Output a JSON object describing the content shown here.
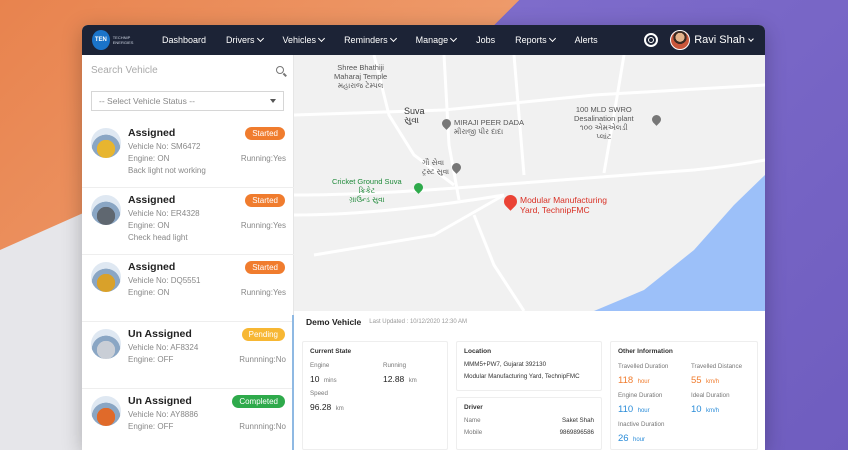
{
  "nav": {
    "logo_text": "TEN",
    "logo_sub": "TECHNIP ENERGIES",
    "items": [
      {
        "label": "Dashboard",
        "dropdown": false
      },
      {
        "label": "Drivers",
        "dropdown": true
      },
      {
        "label": "Vehicles",
        "dropdown": true
      },
      {
        "label": "Reminders",
        "dropdown": true
      },
      {
        "label": "Manage",
        "dropdown": true
      },
      {
        "label": "Jobs",
        "dropdown": false
      },
      {
        "label": "Reports",
        "dropdown": true
      },
      {
        "label": "Alerts",
        "dropdown": false
      }
    ],
    "user_name": "Ravi Shah"
  },
  "sidebar": {
    "search_placeholder": "Search Vehicle",
    "status_select": "-- Select Vehicle Status --",
    "vehicles": [
      {
        "status": "Assigned",
        "vehicle_no": "Vehicle No: SM6472",
        "engine": "Engine: ON",
        "running": "Running:Yes",
        "note": "Back light not working",
        "badge": "Started",
        "badge_type": "started",
        "img_color": "#e7b52f"
      },
      {
        "status": "Assigned",
        "vehicle_no": "Vehicle No: ER4328",
        "engine": "Engine: ON",
        "running": "Running:Yes",
        "note": "Check head light",
        "badge": "Started",
        "badge_type": "started",
        "img_color": "#5f6770"
      },
      {
        "status": "Assigned",
        "vehicle_no": "Vehicle No: DQ5551",
        "engine": "Engine: ON",
        "running": "Running:Yes",
        "note": "",
        "badge": "Started",
        "badge_type": "started",
        "img_color": "#d9a12a"
      },
      {
        "status": "Un Assigned",
        "vehicle_no": "Vehicle No: AF8324",
        "engine": "Engine: OFF",
        "running": "Runnning:No",
        "note": "",
        "badge": "Pending",
        "badge_type": "pending",
        "img_color": "#c9ced6"
      },
      {
        "status": "Un Assigned",
        "vehicle_no": "Vehicle No: AY8886",
        "engine": "Engine: OFF",
        "running": "Runnning:No",
        "note": "",
        "badge": "Completed",
        "badge_type": "completed",
        "img_color": "#e06a2a"
      }
    ]
  },
  "map": {
    "labels": {
      "temple": "Shree Bhathiji\nMaharaj Temple\nમહારાજ ટેમ્પલ",
      "suva": "Suva\nસુવા",
      "miraji": "MIRAJI PEER DADA\nમીરાજી પીર દાદા",
      "swro": "100 MLD SWRO\nDesalination plant\n૧૦૦ એમએલડી\nપ્લાંટ",
      "gau": "ગૌ સેવા\nટ્રસ્ટ સુવા",
      "cricket": "Cricket Ground Suva\nક્રિકેટ\nગ્રાઉન્ડ સુવા",
      "modular": "Modular Manufacturing\nYard, TechnipFMC"
    }
  },
  "details": {
    "title": "Demo Vehicle",
    "last_updated": "Last Updated : 10/12/2020 12:30 AM",
    "current_state": {
      "title": "Current State",
      "engine_label": "Engine",
      "engine_value": "10",
      "engine_unit": "mins",
      "running_label": "Running",
      "running_value": "12.88",
      "running_unit": "km",
      "speed_label": "Speed",
      "speed_value": "96.28",
      "speed_unit": "km"
    },
    "location": {
      "title": "Location",
      "line1": "MMM5+PW7, Gujarat 392130",
      "line2": "Modular Manufacturing Yard, TechnipFMC"
    },
    "driver": {
      "title": "Driver",
      "name_label": "Name",
      "name_value": "Saket Shah",
      "mobile_label": "Mobile",
      "mobile_value": "9869896586"
    },
    "other": {
      "title": "Other Information",
      "travelled_duration_label": "Travelled Duration",
      "travelled_duration_value": "118",
      "travelled_duration_unit": "hour",
      "travelled_distance_label": "Travelled Distance",
      "travelled_distance_value": "55",
      "travelled_distance_unit": "km/h",
      "engine_duration_label": "Engine Duration",
      "engine_duration_value": "110",
      "engine_duration_unit": "hour",
      "ideal_duration_label": "Ideal Duration",
      "ideal_duration_value": "10",
      "ideal_duration_unit": "km/h",
      "inactive_duration_label": "Inactive Duration",
      "inactive_duration_value": "26",
      "inactive_duration_unit": "hour"
    }
  },
  "colors": {
    "nav_bg": "#1c2336",
    "started": "#f07c2e",
    "pending": "#f7b733",
    "completed": "#2eaa4b",
    "map_water": "#9cc0f9",
    "pin_red": "#ea4335"
  }
}
